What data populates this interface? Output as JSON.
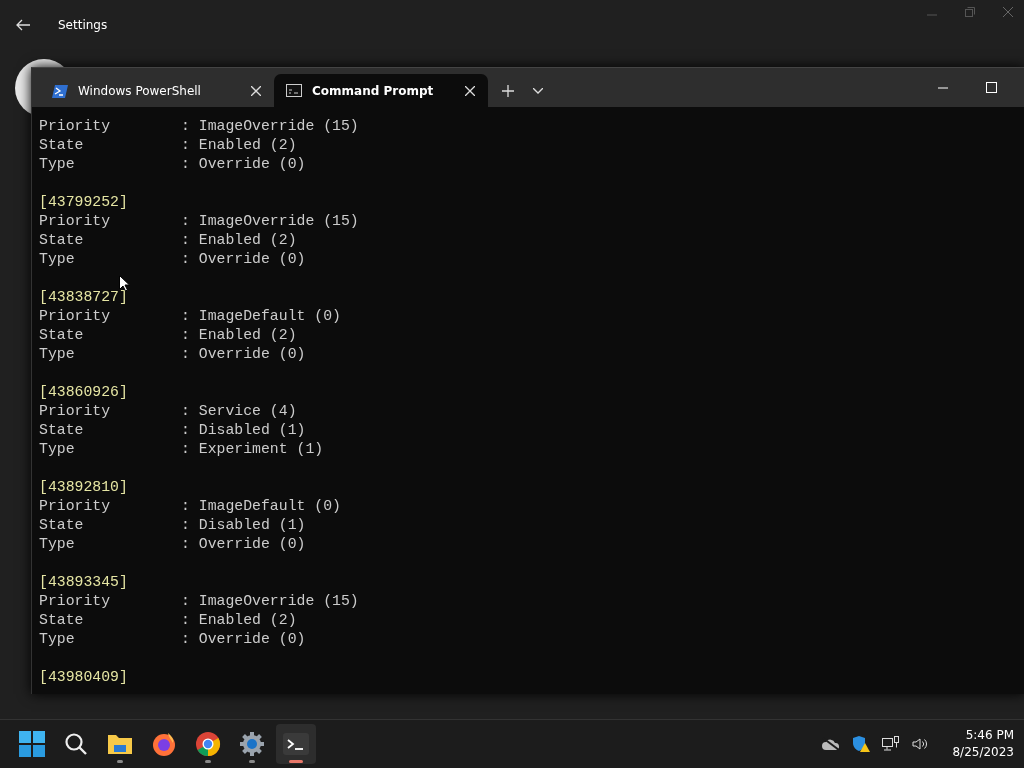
{
  "settings_window": {
    "title": "Settings"
  },
  "terminal": {
    "tabs": [
      {
        "label": "Windows PowerShell",
        "kind": "powershell",
        "selected": false
      },
      {
        "label": "Command Prompt",
        "kind": "cmd",
        "selected": true
      }
    ],
    "blocks": [
      {
        "lines": [
          "Priority        : ImageOverride (15)",
          "State           : Enabled (2)",
          "Type            : Override (0)"
        ]
      },
      {
        "id": "[43799252]",
        "lines": [
          "Priority        : ImageOverride (15)",
          "State           : Enabled (2)",
          "Type            : Override (0)"
        ]
      },
      {
        "id": "[43838727]",
        "lines": [
          "Priority        : ImageDefault (0)",
          "State           : Enabled (2)",
          "Type            : Override (0)"
        ]
      },
      {
        "id": "[43860926]",
        "lines": [
          "Priority        : Service (4)",
          "State           : Disabled (1)",
          "Type            : Experiment (1)"
        ]
      },
      {
        "id": "[43892810]",
        "lines": [
          "Priority        : ImageDefault (0)",
          "State           : Disabled (1)",
          "Type            : Override (0)"
        ]
      },
      {
        "id": "[43893345]",
        "lines": [
          "Priority        : ImageOverride (15)",
          "State           : Enabled (2)",
          "Type            : Override (0)"
        ]
      },
      {
        "id": "[43980409]"
      }
    ]
  },
  "taskbar": {
    "apps": [
      {
        "kind": "start",
        "running": false,
        "active": false
      },
      {
        "kind": "search",
        "running": false,
        "active": false
      },
      {
        "kind": "explorer",
        "running": true,
        "active": false
      },
      {
        "kind": "firefox",
        "running": false,
        "active": false
      },
      {
        "kind": "chrome",
        "running": true,
        "active": false
      },
      {
        "kind": "settings",
        "running": true,
        "active": false
      },
      {
        "kind": "terminal",
        "running": true,
        "active": true
      }
    ],
    "clock": {
      "time": "5:46 PM",
      "date": "8/25/2023"
    }
  }
}
